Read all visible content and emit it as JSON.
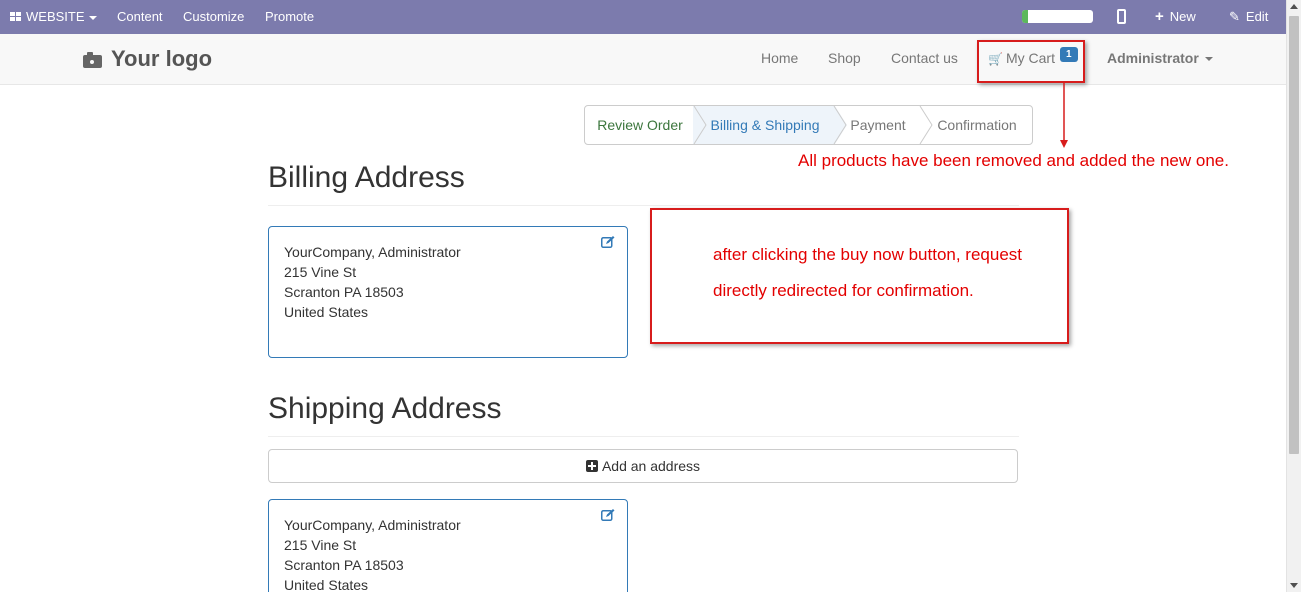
{
  "admin_bar": {
    "website_label": "WEBSITE",
    "menu_items": [
      "Content",
      "Customize",
      "Promote"
    ],
    "progress_fraction": 0.08,
    "new_label": "New",
    "edit_label": "Edit"
  },
  "navbar": {
    "logo_text": "Your logo",
    "links": [
      "Home",
      "Shop",
      "Contact us"
    ],
    "cart_label": "My Cart",
    "cart_count": "1",
    "user_label": "Administrator"
  },
  "steps": [
    {
      "label": "Review Order",
      "state": "done"
    },
    {
      "label": "Billing & Shipping",
      "state": "active"
    },
    {
      "label": "Payment",
      "state": "todo"
    },
    {
      "label": "Confirmation",
      "state": "todo"
    }
  ],
  "billing": {
    "title": "Billing Address",
    "lines": [
      "YourCompany, Administrator",
      "215 Vine St",
      "Scranton PA 18503",
      "United States"
    ]
  },
  "shipping": {
    "title": "Shipping Address",
    "add_label": "Add an address",
    "lines": [
      "YourCompany, Administrator",
      "215 Vine St",
      "Scranton PA 18503",
      "United States"
    ]
  },
  "annotations": {
    "cart_note": "All products have been removed and added the new one.",
    "redirect_line1": "after clicking the buy now button, request",
    "redirect_line2": "directly redirected for confirmation."
  },
  "colors": {
    "admin_bar": "#7c7bad",
    "active_step": "#337ab7",
    "done_step": "#3c763d",
    "annotation": "#e30000"
  }
}
